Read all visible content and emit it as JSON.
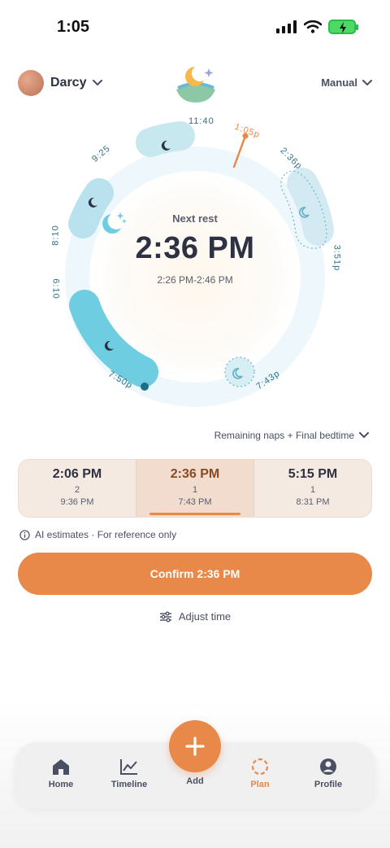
{
  "status": {
    "time": "1:05"
  },
  "header": {
    "user_name": "Darcy",
    "mode_label": "Manual"
  },
  "dial": {
    "labels": [
      "11:40",
      "9:25",
      "8:10",
      "6:10",
      "7:50p",
      "7:43p",
      "3:51p",
      "2:36p",
      "1:05p"
    ],
    "next_label": "Next rest",
    "next_time": "2:36 PM",
    "next_range": "2:26 PM-2:46 PM"
  },
  "dropdown_label": "Remaining naps + Final bedtime",
  "options": [
    {
      "time": "2:06 PM",
      "naps": "2",
      "bedtime": "9:36 PM"
    },
    {
      "time": "2:36 PM",
      "naps": "1",
      "bedtime": "7:43 PM"
    },
    {
      "time": "5:15 PM",
      "naps": "1",
      "bedtime": "8:31 PM"
    }
  ],
  "ai_note": "AI estimates · For reference only",
  "confirm_label": "Confirm 2:36 PM",
  "adjust_label": "Adjust time",
  "nav": {
    "home": "Home",
    "timeline": "Timeline",
    "add": "Add",
    "plan": "Plan",
    "profile": "Profile"
  },
  "colors": {
    "accent": "#e8894a",
    "sleep": "#6ecde0",
    "text": "#2d3142"
  }
}
